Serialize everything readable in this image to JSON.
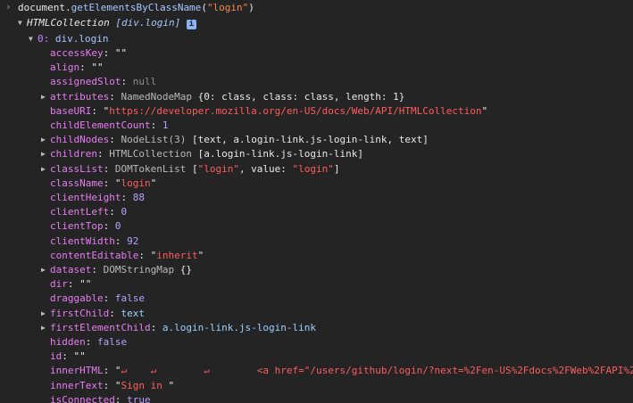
{
  "command": {
    "prefix": "document.",
    "method": "getElementsByClassName",
    "open": "(",
    "arg": "\"login\"",
    "close": ")"
  },
  "collection": {
    "type_label": "HTMLCollection",
    "preview": "[div.login]",
    "info_icon": "i"
  },
  "item0": {
    "index": "0:",
    "value": "div.login"
  },
  "properties": [
    {
      "key": "accessKey",
      "value": "\"\"",
      "kind": "string"
    },
    {
      "key": "align",
      "value": "\"\"",
      "kind": "string"
    },
    {
      "key": "assignedSlot",
      "value": "null",
      "kind": "null"
    },
    {
      "key": "attributes",
      "type": "NamedNodeMap",
      "preview": "{0: class, class: class, length: 1}",
      "expandable": true
    },
    {
      "key": "baseURI",
      "value": "\"https://developer.mozilla.org/en-US/docs/Web/API/HTMLCollection\"",
      "kind": "string"
    },
    {
      "key": "childElementCount",
      "value": "1",
      "kind": "number"
    },
    {
      "key": "childNodes",
      "type": "NodeList(3)",
      "preview": "[text, a.login-link.js-login-link, text]",
      "expandable": true
    },
    {
      "key": "children",
      "type": "HTMLCollection",
      "preview": "[a.login-link.js-login-link]",
      "expandable": true
    },
    {
      "key": "classList",
      "type": "DOMTokenList",
      "preview": "[\"login\", value: \"login\"]",
      "expandable": true
    },
    {
      "key": "className",
      "value": "\"login\"",
      "kind": "string"
    },
    {
      "key": "clientHeight",
      "value": "88",
      "kind": "number"
    },
    {
      "key": "clientLeft",
      "value": "0",
      "kind": "number"
    },
    {
      "key": "clientTop",
      "value": "0",
      "kind": "number"
    },
    {
      "key": "clientWidth",
      "value": "92",
      "kind": "number"
    },
    {
      "key": "contentEditable",
      "value": "\"inherit\"",
      "kind": "string"
    },
    {
      "key": "dataset",
      "type": "DOMStringMap",
      "preview": "{}",
      "expandable": true
    },
    {
      "key": "dir",
      "value": "\"\"",
      "kind": "string"
    },
    {
      "key": "draggable",
      "value": "false",
      "kind": "bool"
    },
    {
      "key": "firstChild",
      "value": "text",
      "kind": "ref",
      "expandable": true
    },
    {
      "key": "firstElementChild",
      "value": "a.login-link.js-login-link",
      "kind": "ref",
      "expandable": true
    },
    {
      "key": "hidden",
      "value": "false",
      "kind": "bool"
    },
    {
      "key": "id",
      "value": "\"\"",
      "kind": "string"
    },
    {
      "key": "innerHTML",
      "value": "\"↵    ↵        ↵        <a href=\"/users/github/login/?next=%2Fen-US%2Fdocs%2FWeb%2FAPI%2",
      "kind": "string"
    },
    {
      "key": "innerText",
      "value": "\"Sign in \"",
      "kind": "string"
    },
    {
      "key": "isConnected",
      "value": "true",
      "kind": "bool"
    }
  ],
  "colors": {
    "background": "#242424",
    "property_key": "#e67ef2",
    "string_value": "#f28b54",
    "number_value": "#b7a2ff",
    "reference_value": "#9ad1ff"
  },
  "icons": {
    "prompt": "chevron-right-icon",
    "expand": "triangle-right-icon",
    "collapse": "triangle-down-icon",
    "info": "info-icon"
  }
}
